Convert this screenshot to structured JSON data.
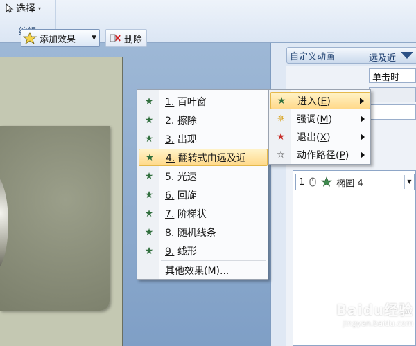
{
  "ribbon": {
    "select_label": "选择",
    "group_label": "编辑"
  },
  "pane": {
    "title": "自定义动画",
    "add_effect_label": "添加效果",
    "delete_label": "删除",
    "partial_label": "远及近",
    "start_value": "单击时",
    "list_row": {
      "index": "1",
      "name": "椭圆 4"
    }
  },
  "menu_main": {
    "items": [
      {
        "num": "1.",
        "label": "百叶窗",
        "icon": "star-entrance-icon"
      },
      {
        "num": "2.",
        "label": "擦除",
        "icon": "star-entrance-icon"
      },
      {
        "num": "3.",
        "label": "出现",
        "icon": "star-entrance-icon"
      },
      {
        "num": "4.",
        "label": "翻转式由远及近",
        "icon": "star-entrance-icon",
        "highlighted": true
      },
      {
        "num": "5.",
        "label": "光速",
        "icon": "star-entrance-icon"
      },
      {
        "num": "6.",
        "label": "回旋",
        "icon": "star-entrance-icon"
      },
      {
        "num": "7.",
        "label": "阶梯状",
        "icon": "star-entrance-icon"
      },
      {
        "num": "8.",
        "label": "随机线条",
        "icon": "star-entrance-icon"
      },
      {
        "num": "9.",
        "label": "线形",
        "icon": "star-entrance-icon"
      }
    ],
    "more_label": "其他效果(M)..."
  },
  "menu_effects": {
    "items": [
      {
        "label": "进入(",
        "key": "E",
        "close": ")",
        "icon": "entrance-star-icon",
        "highlighted": true
      },
      {
        "label": "强调(",
        "key": "M",
        "close": ")",
        "icon": "emphasis-star-icon"
      },
      {
        "label": "退出(",
        "key": "X",
        "close": ")",
        "icon": "exit-star-icon"
      },
      {
        "label": "动作路径(",
        "key": "P",
        "close": ")",
        "icon": "motion-path-star-icon"
      }
    ]
  },
  "watermark": {
    "logo": "Baidu经验",
    "url": "jingyan.baidu.com"
  },
  "colors": {
    "highlight": "#ffd98a",
    "pane_title": "#2b4b78",
    "slide": "#c4c8b2"
  }
}
